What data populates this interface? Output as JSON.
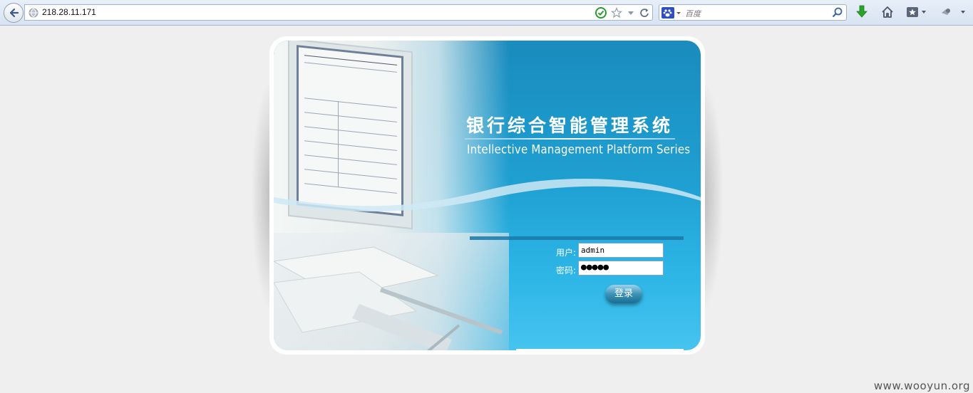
{
  "browser": {
    "url": "218.28.11.171",
    "search_placeholder": "百度",
    "search_engine_icon": "baidu-paw-icon"
  },
  "login": {
    "title_cn": "银行综合智能管理系统",
    "title_en": "Intellective Management Platform Series",
    "username_label": "用户:",
    "username_value": "admin",
    "password_label": "密码:",
    "password_mask": "●●●●●",
    "submit_label": "登录"
  },
  "colors": {
    "panel_blue": "#1f9fd1",
    "panel_light_blue": "#46c4ef",
    "download_green": "#2aa32a"
  },
  "watermark": "www.wooyun.org"
}
